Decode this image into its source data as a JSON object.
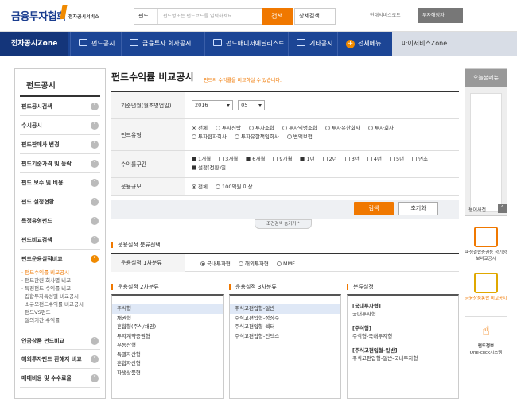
{
  "header": {
    "logo_title": "금융투자협회",
    "logo_subtitle": "전자공시서비스",
    "search_select": "펀드",
    "search_placeholder": "펀드명또는 펀드코드를 입력하세요.",
    "search_button": "검색",
    "advanced_search": "상세검색",
    "other_service": "현대서비스로드",
    "investor_select": "투자해정자"
  },
  "nav": {
    "zone": "전자공시Zone",
    "items": [
      "펀드공시",
      "금융투자 회사공시",
      "펀드매니저에널리스트",
      "기타공시",
      "전체메뉴"
    ],
    "my_zone": "마이서비스Zone"
  },
  "sidebar": {
    "title": "펀드공시",
    "items": [
      "펀드공시검색",
      "수시공시",
      "펀드판매사 변경",
      "펀드기준가격 및 등락",
      "펀드 보수 및 비용",
      "펀드 설정현황",
      "특정유형펀드",
      "펀드비교검색",
      "펀드운용실적비교"
    ],
    "sub_items": [
      "펀드수익률 비교공시",
      "펀드관련 회사별 비교",
      "특정펀드 수익률 비교",
      "집합투자특성별 비교공시",
      "소규모펀드수익률 비교공시",
      "펀드VS펀드",
      "일의기간 수익률"
    ],
    "items_after": [
      "연금상품 펀드비교",
      "해외투자펀드 환해지 비교",
      "매매비용 및 수수료율"
    ]
  },
  "page": {
    "title": "펀드수익률 비교공시",
    "desc": "펀드의 수익률을 비교하실 수 있습니다."
  },
  "form": {
    "date_label": "기준년월(월초영업일)",
    "year": "2016",
    "month": "05",
    "type_label": "펀드유형",
    "type_options": [
      "전체",
      "투자신탁",
      "투자조합",
      "투자익명조합",
      "투자유한회사",
      "투자회사",
      "투자합자회사",
      "투자유한책임회사",
      "변액보험"
    ],
    "range_label": "수익률구간",
    "range_options": [
      "1개월",
      "3개월",
      "6개월",
      "9개월",
      "1년",
      "2년",
      "3년",
      "4년",
      "5년",
      "연초",
      "설정(전환)일"
    ],
    "range_checked": [
      true,
      false,
      true,
      false,
      true,
      false,
      false,
      false,
      false,
      false,
      true
    ],
    "scale_label": "운용규모",
    "scale_options": [
      "전체",
      "100억원 이상"
    ],
    "search_button": "검색",
    "reset_button": "초기화",
    "collapse_label": "조건검색 숨기기"
  },
  "classification": {
    "title": "운용실적 분류선택",
    "cat1_label": "운용실적 1차분류",
    "cat1_options": [
      "국내투자형",
      "해외투자형",
      "MMF"
    ],
    "box2_title": "운용실적 2차분류",
    "box2_items": [
      "주식형",
      "채권형",
      "혼합형(주식/채권)",
      "투자계약증권형",
      "부동산형",
      "특별자산형",
      "혼합자산형",
      "파생상품형"
    ],
    "box3_title": "운용실적 3차분류",
    "box3_items": [
      "주식고편입형-일반",
      "주식고편입형-성장주",
      "주식고편입형-섹터",
      "주식고편입형-인덱스"
    ],
    "box4_title": "분류설정",
    "box4_groups": [
      {
        "head": "[국내투자형]",
        "val": "국내투자형"
      },
      {
        "head": "[주식형]",
        "val": "주식형-국내투자형"
      },
      {
        "head": "[주식고편입형-일반]",
        "val": "주식고편입형-일반-국내투자형"
      }
    ]
  },
  "right": {
    "today_title": "오늘본메뉴",
    "my_time": "용어사전",
    "promo1": "파생결합증권등 정기정보비교공시",
    "promo2": "금융상품통합 비교공시",
    "promo3_a": "펀드정보",
    "promo3_b": "One-click시스템"
  }
}
